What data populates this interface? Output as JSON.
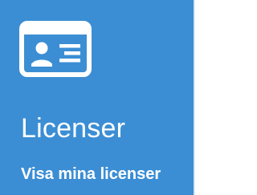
{
  "tile": {
    "icon": "id-card-icon",
    "title": "Licenser",
    "subtitle": "Visa mina licenser",
    "background_color": "#3b8ed4",
    "text_color": "#ffffff"
  }
}
